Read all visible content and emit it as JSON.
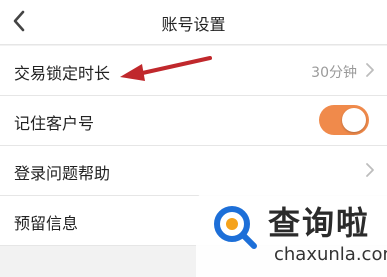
{
  "header": {
    "title": "账号设置"
  },
  "rows": [
    {
      "label": "交易锁定时长",
      "value": "30分钟"
    },
    {
      "label": "记住客户号",
      "toggle_on": true
    },
    {
      "label": "登录问题帮助"
    },
    {
      "label": "预留信息"
    }
  ],
  "watermark": {
    "name": "查询啦",
    "domain": "chaxunla.com"
  },
  "colors": {
    "toggle": "#f08a4b",
    "arrow": "#c0282c",
    "logo_blue": "#1d6fd8",
    "logo_orange": "#f5a21b"
  }
}
